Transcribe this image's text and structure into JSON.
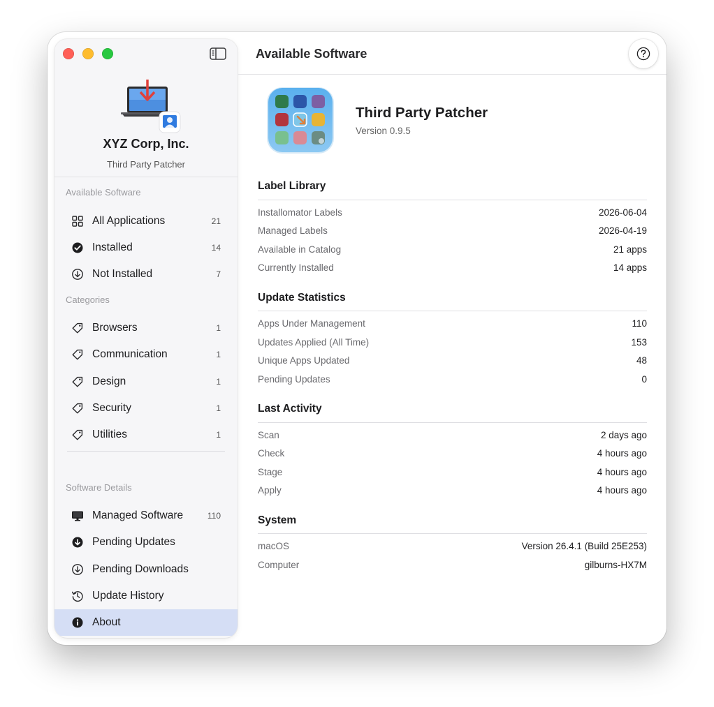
{
  "sidebar": {
    "brand_name": "XYZ Corp, Inc.",
    "brand_subtitle": "Third Party Patcher",
    "sections": {
      "available": "Available Software",
      "categories": "Categories",
      "details": "Software Details"
    },
    "available_items": [
      {
        "label": "All Applications",
        "count": "21",
        "icon": "grid-icon"
      },
      {
        "label": "Installed",
        "count": "14",
        "icon": "checkmark-circle-icon"
      },
      {
        "label": "Not Installed",
        "count": "7",
        "icon": "download-circle-icon"
      }
    ],
    "category_items": [
      {
        "label": "Browsers",
        "count": "1",
        "icon": "tag-icon"
      },
      {
        "label": "Communication",
        "count": "1",
        "icon": "tag-icon"
      },
      {
        "label": "Design",
        "count": "1",
        "icon": "tag-icon"
      },
      {
        "label": "Security",
        "count": "1",
        "icon": "tag-icon"
      },
      {
        "label": "Utilities",
        "count": "1",
        "icon": "tag-icon"
      }
    ],
    "detail_items": [
      {
        "label": "Managed Software",
        "count": "110",
        "icon": "display-icon"
      },
      {
        "label": "Pending Updates",
        "count": "",
        "icon": "download-filled-icon"
      },
      {
        "label": "Pending Downloads",
        "count": "",
        "icon": "download-circle-icon"
      },
      {
        "label": "Update History",
        "count": "",
        "icon": "history-icon"
      },
      {
        "label": "About",
        "count": "",
        "icon": "info-icon",
        "selected": true
      }
    ]
  },
  "header": {
    "title": "Available Software"
  },
  "app": {
    "name": "Third Party Patcher",
    "version": "Version 0.9.5"
  },
  "sections": {
    "label_library": {
      "title": "Label Library",
      "rows": [
        {
          "key": "Installomator Labels",
          "value": "2026-06-04"
        },
        {
          "key": "Managed Labels",
          "value": "2026-04-19"
        },
        {
          "key": "Available in Catalog",
          "value": "21 apps"
        },
        {
          "key": "Currently Installed",
          "value": "14 apps"
        }
      ]
    },
    "update_statistics": {
      "title": "Update Statistics",
      "rows": [
        {
          "key": "Apps Under Management",
          "value": "110"
        },
        {
          "key": "Updates Applied (All Time)",
          "value": "153"
        },
        {
          "key": "Unique Apps Updated",
          "value": "48"
        },
        {
          "key": "Pending Updates",
          "value": "0"
        }
      ]
    },
    "last_activity": {
      "title": "Last Activity",
      "rows": [
        {
          "key": "Scan",
          "value": "2 days ago"
        },
        {
          "key": "Check",
          "value": "4 hours ago"
        },
        {
          "key": "Stage",
          "value": "4 hours ago"
        },
        {
          "key": "Apply",
          "value": "4 hours ago"
        }
      ]
    },
    "system": {
      "title": "System",
      "rows": [
        {
          "key": "macOS",
          "value": "Version 26.4.1 (Build 25E253)"
        },
        {
          "key": "Computer",
          "value": "gilburns-HX7M"
        }
      ]
    }
  },
  "colors": {
    "accent_selected": "#d5def5",
    "close": "#ff5f57",
    "minimize": "#febc2e",
    "zoom": "#28c840"
  }
}
